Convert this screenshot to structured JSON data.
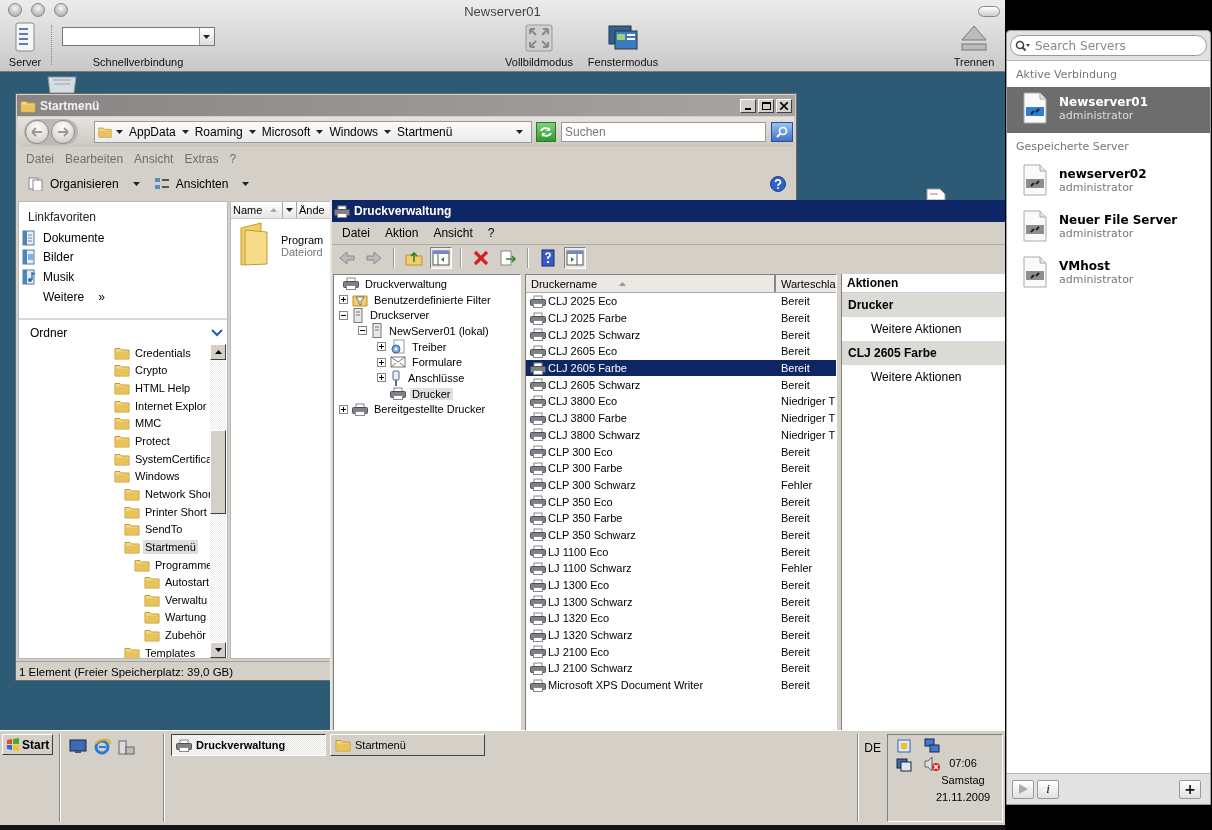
{
  "window": {
    "title": "Newserver01"
  },
  "toolbar": {
    "items": [
      {
        "kind": "server",
        "label": "Server"
      },
      {
        "kind": "quick_connect",
        "label": "Schnellverbindung"
      },
      {
        "kind": "fullscreen",
        "label": "Vollbildmodus"
      },
      {
        "kind": "windowed",
        "label": "Fenstermodus"
      },
      {
        "kind": "disconnect",
        "label": "Trennen"
      }
    ]
  },
  "server_panel": {
    "search": {
      "placeholder": "Search Servers"
    },
    "sections": [
      {
        "title": "Aktive Verbindung",
        "servers": [
          {
            "name": "Newserver01",
            "user": "administrator",
            "selected": true
          }
        ]
      },
      {
        "title": "Gespeicherte Server",
        "servers": [
          {
            "name": "newserver02",
            "user": "administrator",
            "selected": false
          },
          {
            "name": "Neuer File Server",
            "user": "administrator",
            "selected": false
          },
          {
            "name": "VMhost",
            "user": "administrator",
            "selected": false
          }
        ]
      }
    ],
    "buttons": [
      {
        "kind": "info",
        "label": "i"
      },
      {
        "kind": "add",
        "label": "+"
      }
    ]
  },
  "explorer": {
    "title": "Startmenü",
    "address": [
      "AppData",
      "Roaming",
      "Microsoft",
      "Windows",
      "Startmenü"
    ],
    "search": {
      "placeholder": "Suchen"
    },
    "menu": [
      "Datei",
      "Bearbeiten",
      "Ansicht",
      "Extras",
      "?"
    ],
    "toolbar": [
      "Organisieren",
      "Ansichten"
    ],
    "favorites": {
      "title": "Linkfavoriten",
      "links": [
        {
          "kind": "documents",
          "label": "Dokumente"
        },
        {
          "kind": "pictures",
          "label": "Bilder"
        },
        {
          "kind": "music",
          "label": "Musik"
        }
      ],
      "more": "Weitere",
      "more_icon": "»"
    },
    "folders": {
      "title": "Ordner",
      "items": [
        {
          "label": "Credentials",
          "selected": false
        },
        {
          "label": "Crypto",
          "selected": false
        },
        {
          "label": "HTML Help",
          "selected": false
        },
        {
          "label": "Internet Explor",
          "selected": false
        },
        {
          "label": "MMC",
          "selected": false
        },
        {
          "label": "Protect",
          "selected": false
        },
        {
          "label": "SystemCertifica",
          "selected": false
        },
        {
          "label": "Windows",
          "selected": false,
          "children": [
            {
              "label": "Network Shor",
              "selected": false
            },
            {
              "label": "Printer Short",
              "selected": false
            },
            {
              "label": "SendTo",
              "selected": false
            },
            {
              "label": "Startmenü",
              "selected": true,
              "children": [
                {
                  "label": "Programme",
                  "selected": false,
                  "children": [
                    {
                      "label": "Autostart",
                      "selected": false
                    },
                    {
                      "label": "Verwaltu",
                      "selected": false
                    },
                    {
                      "label": "Wartung",
                      "selected": false
                    },
                    {
                      "label": "Zubehör",
                      "selected": false
                    }
                  ]
                }
              ]
            },
            {
              "label": "Templates",
              "selected": false
            }
          ]
        }
      ]
    },
    "columns": [
      "Name",
      "Ände"
    ],
    "files": [
      {
        "name": "Program",
        "type": "Dateiord"
      }
    ],
    "status_bar": "1 Element (Freier Speicherplatz: 39,0 GB)"
  },
  "print_management": {
    "title": "Druckverwaltung",
    "menu": [
      "Datei",
      "Aktion",
      "Ansicht",
      "?"
    ],
    "tree": [
      {
        "label": "Druckverwaltung",
        "kind": "root",
        "toggle": false,
        "selected": false,
        "children": [
          {
            "label": "Benutzerdefinierte Filter",
            "kind": "filter",
            "toggle": true,
            "expanded": false,
            "selected": false
          },
          {
            "label": "Druckserver",
            "kind": "servers",
            "toggle": true,
            "expanded": true,
            "selected": false,
            "children": [
              {
                "label": "NewServer01 (lokal)",
                "kind": "server",
                "toggle": true,
                "expanded": true,
                "selected": false,
                "children": [
                  {
                    "label": "Treiber",
                    "kind": "drivers",
                    "toggle": true,
                    "expanded": false,
                    "selected": false
                  },
                  {
                    "label": "Formulare",
                    "kind": "forms",
                    "toggle": true,
                    "expanded": false,
                    "selected": false
                  },
                  {
                    "label": "Anschlüsse",
                    "kind": "ports",
                    "toggle": true,
                    "expanded": false,
                    "selected": false
                  },
                  {
                    "label": "Drucker",
                    "kind": "printers",
                    "toggle": false,
                    "selected": true
                  }
                ]
              }
            ]
          },
          {
            "label": "Bereitgestellte Drucker",
            "kind": "deployed",
            "toggle": true,
            "expanded": false,
            "selected": false
          }
        ]
      }
    ],
    "columns": [
      "Druckername",
      "Warteschla"
    ],
    "printers": [
      {
        "name": "CLJ 2025 Eco",
        "status": "Bereit",
        "selected": false
      },
      {
        "name": "CLJ 2025 Farbe",
        "status": "Bereit",
        "selected": false
      },
      {
        "name": "CLJ 2025 Schwarz",
        "status": "Bereit",
        "selected": false
      },
      {
        "name": "CLJ 2605 Eco",
        "status": "Bereit",
        "selected": false
      },
      {
        "name": "CLJ 2605 Farbe",
        "status": "Bereit",
        "selected": true
      },
      {
        "name": "CLJ 2605 Schwarz",
        "status": "Bereit",
        "selected": false
      },
      {
        "name": "CLJ 3800 Eco",
        "status": "Niedriger T",
        "selected": false
      },
      {
        "name": "CLJ 3800 Farbe",
        "status": "Niedriger T",
        "selected": false
      },
      {
        "name": "CLJ 3800 Schwarz",
        "status": "Niedriger T",
        "selected": false
      },
      {
        "name": "CLP 300 Eco",
        "status": "Bereit",
        "selected": false
      },
      {
        "name": "CLP 300 Farbe",
        "status": "Bereit",
        "selected": false
      },
      {
        "name": "CLP 300 Schwarz",
        "status": "Fehler",
        "selected": false
      },
      {
        "name": "CLP 350 Eco",
        "status": "Bereit",
        "selected": false
      },
      {
        "name": "CLP 350 Farbe",
        "status": "Bereit",
        "selected": false
      },
      {
        "name": "CLP 350 Schwarz",
        "status": "Bereit",
        "selected": false
      },
      {
        "name": "LJ 1100 Eco",
        "status": "Bereit",
        "selected": false
      },
      {
        "name": "LJ 1100 Schwarz",
        "status": "Fehler",
        "selected": false
      },
      {
        "name": "LJ 1300 Eco",
        "status": "Bereit",
        "selected": false
      },
      {
        "name": "LJ 1300 Schwarz",
        "status": "Bereit",
        "selected": false
      },
      {
        "name": "LJ 1320 Eco",
        "status": "Bereit",
        "selected": false
      },
      {
        "name": "LJ 1320 Schwarz",
        "status": "Bereit",
        "selected": false
      },
      {
        "name": "LJ 2100 Eco",
        "status": "Bereit",
        "selected": false
      },
      {
        "name": "LJ 2100 Schwarz",
        "status": "Bereit",
        "selected": false
      },
      {
        "name": "Microsoft XPS Document Writer",
        "status": "Bereit",
        "selected": false
      }
    ],
    "actions": {
      "title": "Aktionen",
      "sections": [
        {
          "title": "Drucker",
          "items": [
            "Weitere Aktionen"
          ]
        },
        {
          "title": "CLJ 2605 Farbe",
          "items": [
            "Weitere Aktionen"
          ]
        }
      ]
    }
  },
  "taskbar": {
    "start": "Start",
    "tasks": [
      {
        "label": "Druckverwaltung",
        "kind": "printer",
        "selected": true
      },
      {
        "label": "Startmenü",
        "kind": "folder",
        "selected": false
      }
    ],
    "language": "DE",
    "clock": {
      "time": "07:06",
      "day": "Samstag",
      "date": "21.11.2009"
    }
  }
}
